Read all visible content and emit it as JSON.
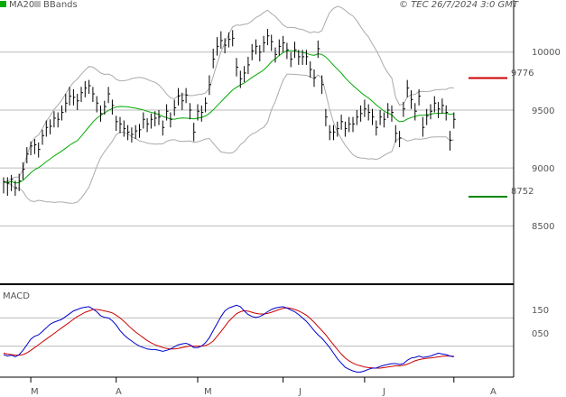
{
  "header": {
    "ma_label": "MA20",
    "bb_label": "BBands",
    "source": "© TEC 26/7/2024 3:0 GMT"
  },
  "macd_panel": {
    "title": "MACD"
  },
  "levels": {
    "resistance": {
      "text": "9776",
      "value": 9776,
      "color": "#cc0000"
    },
    "support": {
      "text": "8752",
      "value": 8752,
      "color": "#008800"
    }
  },
  "colors": {
    "bars": "#000000",
    "ma": "#00aa00",
    "bbands": "#aaaaaa",
    "macd": "#0000cc",
    "signal": "#cc0000",
    "grid": "#bbbbbb",
    "axis": "#000000"
  },
  "chart_data": [
    {
      "type": "ohlc",
      "title": "",
      "ylim": [
        8020,
        10450
      ],
      "yticks": [
        {
          "value": 10000,
          "label": "10000"
        },
        {
          "value": 9500,
          "label": "9500"
        },
        {
          "value": 9000,
          "label": "9000"
        },
        {
          "value": 8500,
          "label": "8500"
        }
      ],
      "months": [
        {
          "label": "M",
          "index": 7
        },
        {
          "label": "A",
          "index": 29
        },
        {
          "label": "M",
          "index": 50
        },
        {
          "label": "J",
          "index": 72
        },
        {
          "label": "J",
          "index": 93
        },
        {
          "label": "A",
          "index": 116
        }
      ],
      "close": [
        8880,
        8870,
        8900,
        8830,
        8890,
        8990,
        9120,
        9190,
        9200,
        9160,
        9280,
        9350,
        9360,
        9430,
        9420,
        9480,
        9560,
        9620,
        9610,
        9580,
        9650,
        9690,
        9710,
        9640,
        9560,
        9470,
        9530,
        9640,
        9540,
        9400,
        9380,
        9340,
        9310,
        9290,
        9320,
        9330,
        9420,
        9380,
        9420,
        9430,
        9440,
        9350,
        9490,
        9420,
        9520,
        9620,
        9580,
        9630,
        9500,
        9310,
        9490,
        9480,
        9560,
        9720,
        9940,
        10050,
        10100,
        10060,
        10110,
        10120,
        9870,
        9770,
        9820,
        9890,
        10010,
        10050,
        10000,
        10080,
        10140,
        10090,
        9980,
        10050,
        10080,
        10020,
        9940,
        10020,
        9960,
        9960,
        9960,
        9850,
        9780,
        10030,
        9720,
        9440,
        9310,
        9310,
        9340,
        9400,
        9340,
        9380,
        9380,
        9440,
        9470,
        9510,
        9480,
        9440,
        9350,
        9440,
        9420,
        9500,
        9480,
        9300,
        9260,
        9510,
        9690,
        9590,
        9490,
        9620,
        9350,
        9450,
        9490,
        9560,
        9510,
        9540,
        9480,
        9240,
        9420
      ],
      "high": [
        8920,
        8920,
        8940,
        8890,
        8950,
        9050,
        9180,
        9230,
        9250,
        9220,
        9330,
        9410,
        9420,
        9490,
        9480,
        9540,
        9640,
        9700,
        9680,
        9640,
        9700,
        9750,
        9760,
        9700,
        9620,
        9540,
        9580,
        9700,
        9590,
        9450,
        9440,
        9410,
        9370,
        9350,
        9370,
        9380,
        9480,
        9430,
        9470,
        9490,
        9500,
        9410,
        9550,
        9480,
        9590,
        9690,
        9650,
        9690,
        9560,
        9390,
        9550,
        9540,
        9610,
        9800,
        10030,
        10130,
        10180,
        10120,
        10170,
        10190,
        9950,
        9840,
        9880,
        9960,
        10070,
        10110,
        10060,
        10140,
        10200,
        10150,
        10040,
        10110,
        10140,
        10080,
        10000,
        10090,
        10020,
        10020,
        10020,
        9920,
        9850,
        10100,
        9800,
        9510,
        9370,
        9370,
        9400,
        9460,
        9400,
        9440,
        9440,
        9500,
        9540,
        9590,
        9550,
        9510,
        9410,
        9500,
        9480,
        9560,
        9540,
        9370,
        9320,
        9570,
        9760,
        9670,
        9560,
        9680,
        9440,
        9510,
        9550,
        9620,
        9570,
        9600,
        9540,
        9320,
        9480
      ],
      "low": [
        8780,
        8760,
        8800,
        8760,
        8800,
        8900,
        9040,
        9110,
        9120,
        9090,
        9200,
        9270,
        9290,
        9350,
        9350,
        9410,
        9480,
        9540,
        9540,
        9500,
        9570,
        9610,
        9640,
        9570,
        9480,
        9400,
        9460,
        9560,
        9460,
        9320,
        9300,
        9270,
        9240,
        9220,
        9250,
        9260,
        9340,
        9310,
        9340,
        9360,
        9370,
        9280,
        9410,
        9350,
        9450,
        9540,
        9500,
        9560,
        9420,
        9230,
        9410,
        9400,
        9480,
        9630,
        9860,
        9970,
        10030,
        9990,
        10040,
        10050,
        9790,
        9690,
        9740,
        9810,
        9930,
        9980,
        9920,
        10000,
        10060,
        10010,
        9910,
        9970,
        10000,
        9940,
        9870,
        9950,
        9890,
        9890,
        9890,
        9780,
        9700,
        9950,
        9640,
        9360,
        9240,
        9240,
        9270,
        9330,
        9270,
        9310,
        9310,
        9370,
        9400,
        9440,
        9410,
        9370,
        9280,
        9370,
        9350,
        9430,
        9400,
        9220,
        9180,
        9440,
        9610,
        9510,
        9410,
        9540,
        9270,
        9370,
        9420,
        9480,
        9430,
        9470,
        9410,
        9150,
        9340
      ]
    },
    {
      "type": "line",
      "title": "",
      "ylim": [
        -0.6,
        2.6
      ],
      "yticks": [
        {
          "value": 1.5,
          "label": "150"
        },
        {
          "value": 0.5,
          "label": "050"
        }
      ],
      "series": [
        {
          "values": [
            0.2,
            0.15,
            0.18,
            0.12,
            0.2,
            0.35,
            0.55,
            0.75,
            0.85,
            0.9,
            1.02,
            1.15,
            1.28,
            1.35,
            1.4,
            1.45,
            1.55,
            1.65,
            1.75,
            1.8,
            1.85,
            1.88,
            1.9,
            1.82,
            1.72,
            1.58,
            1.52,
            1.5,
            1.4,
            1.25,
            1.05,
            0.9,
            0.78,
            0.68,
            0.58,
            0.5,
            0.45,
            0.4,
            0.38,
            0.38,
            0.35,
            0.32,
            0.35,
            0.4,
            0.48,
            0.55,
            0.58,
            0.6,
            0.55,
            0.45,
            0.45,
            0.5,
            0.62,
            0.8,
            1.05,
            1.3,
            1.55,
            1.75,
            1.85,
            1.9,
            1.95,
            1.9,
            1.75,
            1.62,
            1.55,
            1.52,
            1.55,
            1.62,
            1.72,
            1.8,
            1.85,
            1.88,
            1.9,
            1.85,
            1.78,
            1.72,
            1.62,
            1.5,
            1.38,
            1.22,
            1.05,
            0.9,
            0.78,
            0.62,
            0.45,
            0.25,
            0.05,
            -0.1,
            -0.25,
            -0.32,
            -0.38,
            -0.42,
            -0.42,
            -0.38,
            -0.32,
            -0.28,
            -0.28,
            -0.22,
            -0.18,
            -0.15,
            -0.12,
            -0.12,
            -0.15,
            -0.12,
            0.0,
            0.08,
            0.1,
            0.15,
            0.1,
            0.12,
            0.15,
            0.2,
            0.25,
            0.22,
            0.2,
            0.15,
            0.12
          ]
        },
        {
          "values": [
            0.25,
            0.22,
            0.2,
            0.18,
            0.18,
            0.2,
            0.26,
            0.35,
            0.45,
            0.55,
            0.65,
            0.75,
            0.85,
            0.95,
            1.05,
            1.15,
            1.25,
            1.35,
            1.45,
            1.55,
            1.62,
            1.7,
            1.75,
            1.8,
            1.8,
            1.78,
            1.75,
            1.72,
            1.68,
            1.6,
            1.5,
            1.38,
            1.25,
            1.12,
            1.0,
            0.9,
            0.8,
            0.7,
            0.62,
            0.55,
            0.5,
            0.45,
            0.42,
            0.4,
            0.4,
            0.42,
            0.45,
            0.48,
            0.5,
            0.5,
            0.5,
            0.5,
            0.52,
            0.58,
            0.68,
            0.85,
            1.02,
            1.2,
            1.38,
            1.52,
            1.65,
            1.72,
            1.76,
            1.74,
            1.7,
            1.66,
            1.64,
            1.64,
            1.66,
            1.7,
            1.75,
            1.8,
            1.84,
            1.86,
            1.84,
            1.8,
            1.75,
            1.68,
            1.6,
            1.48,
            1.35,
            1.2,
            1.05,
            0.9,
            0.72,
            0.55,
            0.38,
            0.22,
            0.08,
            -0.02,
            -0.1,
            -0.16,
            -0.2,
            -0.24,
            -0.26,
            -0.27,
            -0.28,
            -0.28,
            -0.26,
            -0.24,
            -0.22,
            -0.2,
            -0.2,
            -0.18,
            -0.14,
            -0.08,
            -0.02,
            0.02,
            0.05,
            0.07,
            0.08,
            0.1,
            0.12,
            0.14,
            0.15,
            0.15,
            0.14
          ]
        }
      ]
    }
  ]
}
